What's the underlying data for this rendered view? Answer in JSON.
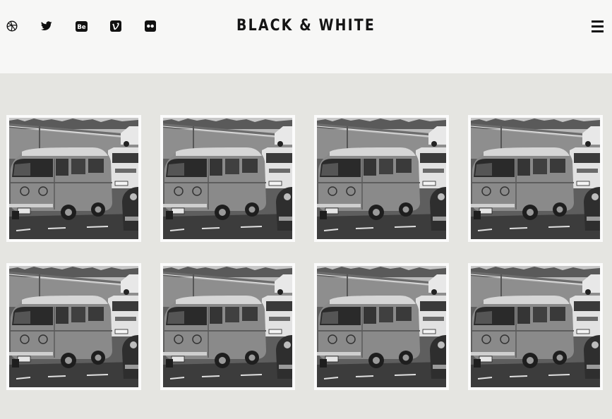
{
  "header": {
    "title": "BLACK & WHITE",
    "social_icons": [
      "dribbble-icon",
      "twitter-icon",
      "behance-icon",
      "vimeo-icon",
      "flickr-icon"
    ],
    "menu_icon": "hamburger-menu-icon"
  },
  "gallery": {
    "items": [
      {
        "icon": "photo-vw-bus"
      },
      {
        "icon": "photo-vw-bus"
      },
      {
        "icon": "photo-vw-bus"
      },
      {
        "icon": "photo-vw-bus"
      },
      {
        "icon": "photo-vw-bus"
      },
      {
        "icon": "photo-vw-bus"
      },
      {
        "icon": "photo-vw-bus"
      },
      {
        "icon": "photo-vw-bus"
      }
    ]
  },
  "colors": {
    "page_background": "#e5e5e1",
    "header_background": "#f7f7f6",
    "title_text": "#151515"
  }
}
